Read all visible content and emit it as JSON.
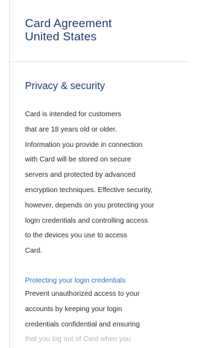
{
  "header": {
    "line1": "Card Agreement",
    "line2": "United States"
  },
  "privacy": {
    "heading": "Privacy & security",
    "paragraph_lines": [
      "Card is intended for customers",
      "that are 18 years old or older.",
      "Information you provide in connection",
      "with Card will be stored on secure",
      "servers and protected by advanced",
      "encryption techniques. Effective security,",
      "however, depends on you protecting your",
      "login credentials and controlling access",
      "to the devices you use to access",
      "Card."
    ]
  },
  "protecting": {
    "link": "Protecting your login credentials",
    "paragraph_lines": [
      "Prevent unauthorized access to your",
      "accounts by keeping your login",
      "credentials confidential and ensuring",
      "that you log out of Card when you"
    ]
  },
  "colors": {
    "heading": "#1f3b6e",
    "body": "#2b2b2b",
    "link": "#2d72c8"
  }
}
